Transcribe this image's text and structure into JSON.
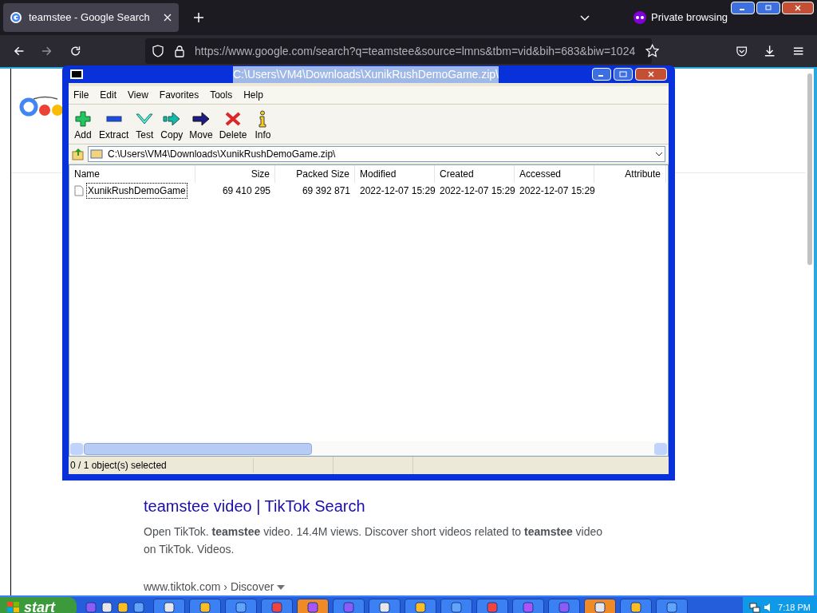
{
  "browser": {
    "tab": {
      "title": "teamstee - Google Search",
      "selected": true
    },
    "private_label": "Private browsing",
    "url": "https://www.google.com/search?q=teamstee&source=lmns&tbm=vid&bih=683&biw=1024"
  },
  "page": {
    "results": [
      {
        "title": "teamstee video | TikTok Search",
        "snippet": "Open TikTok. **teamstee** video. 14.4M views. Discover short videos related to **teamstee** video on TikTok. Videos."
      },
      {
        "cite": "www.tiktok.com › Discover"
      }
    ]
  },
  "archive_window": {
    "title": "C:\\Users\\VM4\\Downloads\\XunikRushDemoGame.zip\\",
    "menu": [
      "File",
      "Edit",
      "View",
      "Favorites",
      "Tools",
      "Help"
    ],
    "toolbar": [
      {
        "kind": "add",
        "label": "Add"
      },
      {
        "kind": "extract",
        "label": "Extract"
      },
      {
        "kind": "test",
        "label": "Test"
      },
      {
        "kind": "copy",
        "label": "Copy"
      },
      {
        "kind": "move",
        "label": "Move"
      },
      {
        "kind": "delete",
        "label": "Delete"
      },
      {
        "kind": "info",
        "label": "Info"
      }
    ],
    "path": "C:\\Users\\VM4\\Downloads\\XunikRushDemoGame.zip\\",
    "columns": [
      "Name",
      "Size",
      "Packed Size",
      "Modified",
      "Created",
      "Accessed",
      "Attribute"
    ],
    "rows": [
      {
        "selected": false,
        "cells": [
          "XunikRushDemoGame",
          "69 410 295",
          "69 392 871",
          "2022-12-07 15:29",
          "2022-12-07 15:29",
          "2022-12-07 15:29"
        ]
      }
    ],
    "status": "0 / 1 object(s) selected"
  },
  "taskbar": {
    "start": "start",
    "tasks": [
      {
        "flashing": false
      },
      {
        "flashing": false
      },
      {
        "flashing": false
      },
      {
        "flashing": false
      },
      {
        "flashing": true
      },
      {
        "flashing": false
      },
      {
        "flashing": false
      },
      {
        "flashing": false
      },
      {
        "flashing": false
      },
      {
        "flashing": false
      },
      {
        "flashing": false
      },
      {
        "flashing": false
      },
      {
        "flashing": true
      },
      {
        "flashing": false
      },
      {
        "flashing": false
      }
    ],
    "clock": "7:18 PM"
  }
}
